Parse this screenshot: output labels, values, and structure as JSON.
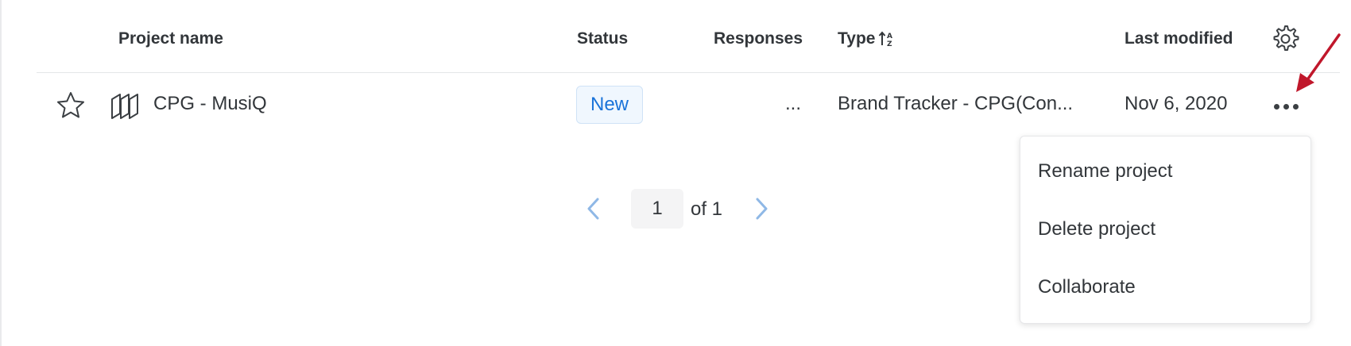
{
  "table": {
    "headers": {
      "project_name": "Project name",
      "status": "Status",
      "responses": "Responses",
      "type": "Type",
      "last_modified": "Last modified"
    },
    "rows": [
      {
        "favorite": false,
        "name": "CPG - MusiQ",
        "status": "New",
        "responses": "...",
        "type": "Brand Tracker - CPG(Con...",
        "last_modified": "Nov 6, 2020"
      }
    ]
  },
  "pagination": {
    "current_page": "1",
    "of_label": "of 1"
  },
  "context_menu": {
    "items": [
      "Rename project",
      "Delete project",
      "Collaborate"
    ]
  },
  "icons": {
    "settings": "gear-icon",
    "sort": "sort-ascending-icon",
    "favorite": "star-icon",
    "project": "project-stack-icon",
    "more": "more-dots-icon",
    "prev": "chevron-left-icon",
    "next": "chevron-right-icon"
  },
  "colors": {
    "status_badge_text": "#1a73d9",
    "status_badge_bg": "#f0f7fe",
    "pager_chevron": "#8fb8e6",
    "annotation_arrow": "#c0172b"
  }
}
